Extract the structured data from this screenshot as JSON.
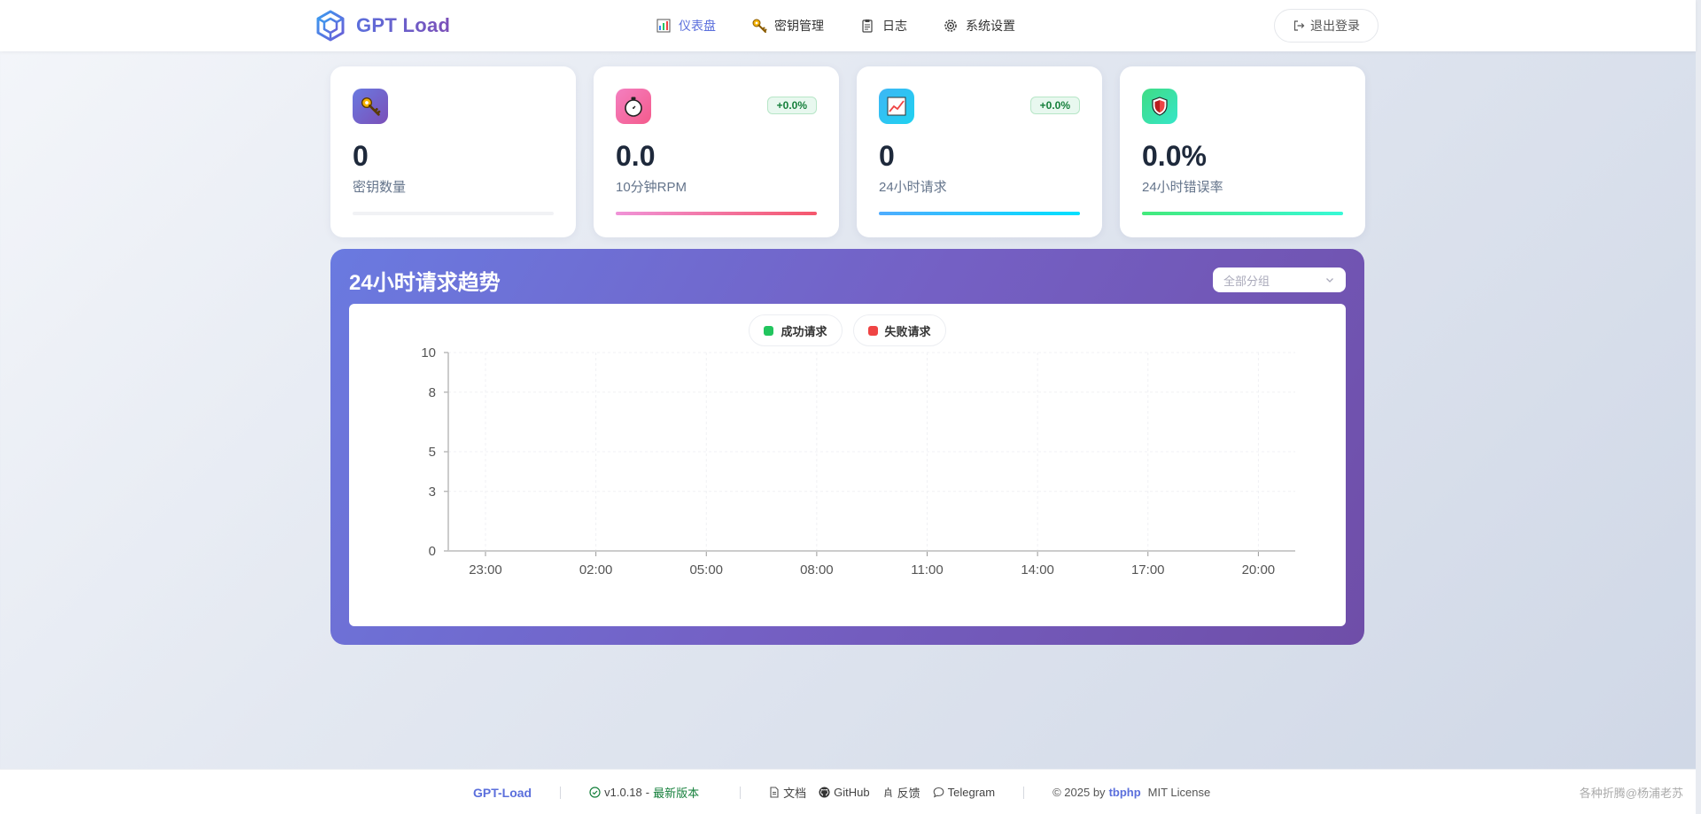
{
  "header": {
    "app_name": "GPT Load",
    "nav": [
      {
        "label": "仪表盘",
        "icon": "chart-icon",
        "active": true
      },
      {
        "label": "密钥管理",
        "icon": "key-icon",
        "active": false
      },
      {
        "label": "日志",
        "icon": "clipboard-icon",
        "active": false
      },
      {
        "label": "系统设置",
        "icon": "gear-icon",
        "active": false
      }
    ],
    "logout_label": "退出登录"
  },
  "stats": [
    {
      "value": "0",
      "label": "密钥数量",
      "icon": "key-icon",
      "badge": "",
      "progress": 0
    },
    {
      "value": "0.0",
      "label": "10分钟RPM",
      "icon": "stopwatch-icon",
      "badge": "+0.0%",
      "progress": 1
    },
    {
      "value": "0",
      "label": "24小时请求",
      "icon": "trend-chart-icon",
      "badge": "+0.0%",
      "progress": 1
    },
    {
      "value": "0.0%",
      "label": "24小时错误率",
      "icon": "shield-icon",
      "badge": "",
      "progress": 1
    }
  ],
  "panel": {
    "title": "24小时请求趋势",
    "group_select": "全部分组"
  },
  "chart_data": {
    "type": "line",
    "categories": [
      "23:00",
      "02:00",
      "05:00",
      "08:00",
      "11:00",
      "14:00",
      "17:00",
      "20:00"
    ],
    "series": [
      {
        "name": "成功请求",
        "color": "#22c55e",
        "values": []
      },
      {
        "name": "失败请求",
        "color": "#ef4444",
        "values": []
      }
    ],
    "yticks": [
      "0",
      "3",
      "5",
      "8",
      "10"
    ],
    "ylim": [
      0,
      10
    ],
    "grid": true,
    "legend": "top-center"
  },
  "footer": {
    "brand": "GPT-Load",
    "version": "v1.0.18",
    "version_status": "最新版本",
    "links": [
      {
        "label": "文档",
        "icon": "document-icon"
      },
      {
        "label": "GitHub",
        "icon": "github-icon"
      },
      {
        "label": "反馈",
        "icon": "feedback-icon"
      },
      {
        "label": "Telegram",
        "icon": "chat-icon"
      }
    ],
    "copyright": "© 2025 by",
    "author": "tbphp",
    "license": "MIT License",
    "credit": "各种折腾@杨浦老苏"
  }
}
